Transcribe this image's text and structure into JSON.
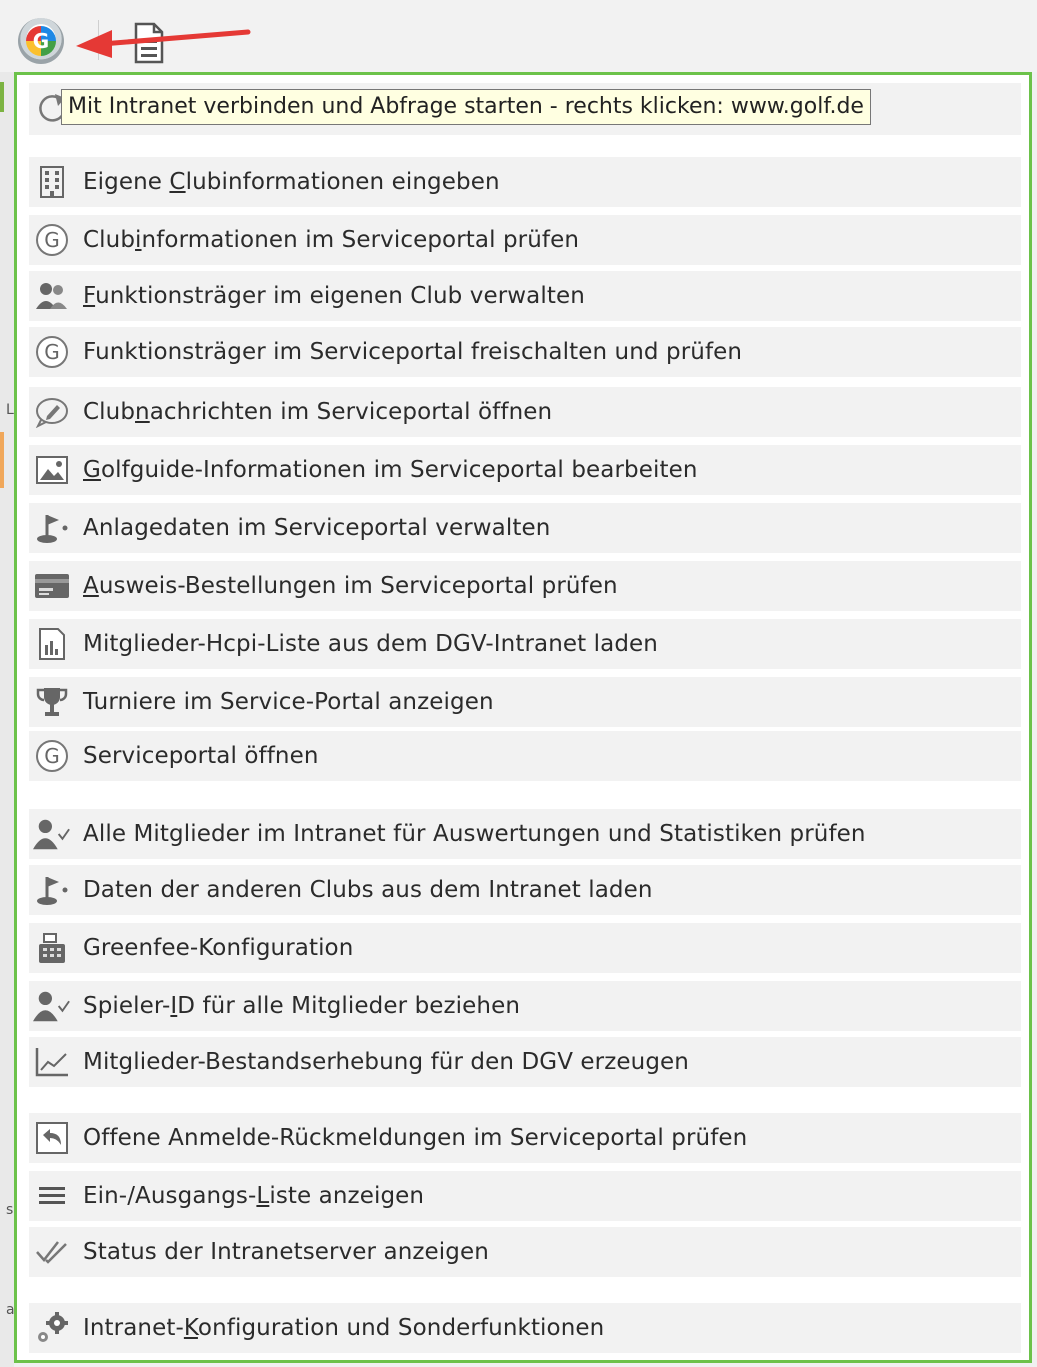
{
  "tooltip": "Mit Intranet verbinden und Abfrage starten - rechts klicken: www.golf.de",
  "toolbar": {
    "g_button_glyph": "G",
    "g_button_icon": "golf-intranet-g-icon",
    "doc_button_icon": "document-icon",
    "arrow_color": "#e53935"
  },
  "colors": {
    "menu_border": "#6cc24a",
    "item_bg": "#f2f2f2",
    "tooltip_bg": "#ffffe1"
  },
  "menu": {
    "groups": [
      {
        "items": [
          {
            "label_pre": "Eigene ",
            "label_ul": "C",
            "label_post": "lubinformationen eingeben",
            "icon": "building-icon"
          },
          {
            "label_pre": "Club",
            "label_ul": "i",
            "label_post": "nformationen im Serviceportal prüfen",
            "icon": "g-circle-icon"
          },
          {
            "label_pre": "",
            "label_ul": "F",
            "label_post": "unktionsträger im eigenen Club verwalten",
            "icon": "people-icon"
          },
          {
            "label_pre": "Funktionsträger im Serviceportal freischalten und prüfen",
            "label_ul": "",
            "label_post": "",
            "icon": "g-circle-icon"
          },
          {
            "label_pre": "Club",
            "label_ul": "n",
            "label_post": "achrichten im Serviceportal öffnen",
            "icon": "chat-pencil-icon"
          },
          {
            "label_pre": "",
            "label_ul": "G",
            "label_post": "olfguide-Informationen im Serviceportal bearbeiten",
            "icon": "image-icon"
          },
          {
            "label_pre": "Anlagedaten im Serviceportal verwalten",
            "label_ul": "",
            "label_post": "",
            "icon": "golf-flag-icon"
          },
          {
            "label_pre": "",
            "label_ul": "A",
            "label_post": "usweis-Bestellungen im Serviceportal prüfen",
            "icon": "id-card-icon"
          },
          {
            "label_pre": "Mitglieder-Hcpi-Liste aus dem DGV-Intranet laden",
            "label_ul": "",
            "label_post": "",
            "icon": "chart-document-icon"
          },
          {
            "label_pre": "Turniere im Service-Portal anzeigen",
            "label_ul": "",
            "label_post": "",
            "icon": "trophy-icon"
          },
          {
            "label_pre": "Serviceportal öffnen",
            "label_ul": "",
            "label_post": "",
            "icon": "g-circle-icon"
          }
        ]
      },
      {
        "items": [
          {
            "label_pre": "Alle Mitglieder im Intranet für Auswertungen und Statistiken prüfen",
            "label_ul": "",
            "label_post": "",
            "icon": "user-check-icon"
          },
          {
            "label_pre": "Daten der anderen Clubs aus dem Intranet laden",
            "label_ul": "",
            "label_post": "",
            "icon": "golf-flag-icon"
          },
          {
            "label_pre": "Greenfee-Konfiguration",
            "label_ul": "",
            "label_post": "",
            "icon": "cash-register-icon"
          },
          {
            "label_pre": "Spieler-",
            "label_ul": "I",
            "label_post": "D für alle Mitglieder beziehen",
            "icon": "user-check-icon"
          },
          {
            "label_pre": "Mitglieder-Bestandserhebung für den DGV erzeugen",
            "label_ul": "",
            "label_post": "",
            "icon": "line-chart-icon"
          }
        ]
      },
      {
        "items": [
          {
            "label_pre": "Offene Anmelde-Rückmeldungen im Serviceportal prüfen",
            "label_ul": "",
            "label_post": "",
            "icon": "reply-icon"
          },
          {
            "label_pre": "Ein-/Ausgangs-",
            "label_ul": "L",
            "label_post": "iste anzeigen",
            "icon": "list-icon"
          },
          {
            "label_pre": "Status der Intranetserver anzeigen",
            "label_ul": "",
            "label_post": "",
            "icon": "double-check-icon"
          }
        ]
      },
      {
        "items": [
          {
            "label_pre": "Intranet-",
            "label_ul": "K",
            "label_post": "onfiguration und Sonderfunktionen",
            "icon": "gears-icon"
          }
        ]
      }
    ]
  }
}
